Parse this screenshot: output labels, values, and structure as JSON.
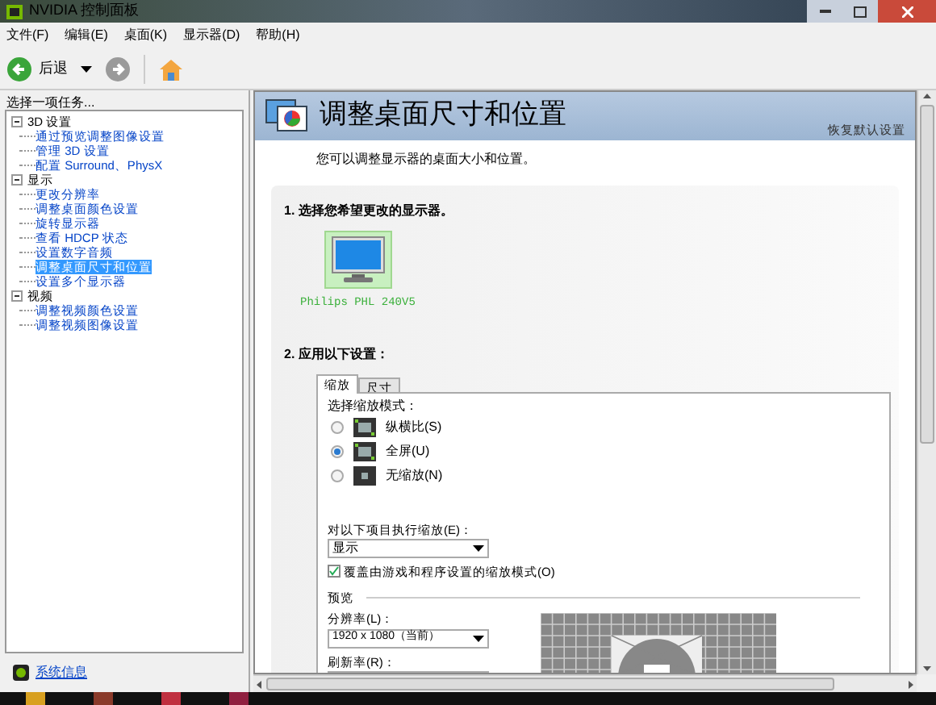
{
  "window": {
    "title": "NVIDIA 控制面板"
  },
  "menu": [
    "文件(F)",
    "编辑(E)",
    "桌面(K)",
    "显示器(D)",
    "帮助(H)"
  ],
  "toolbar": {
    "back": "后退"
  },
  "sidebar": {
    "heading": "选择一项任务...",
    "tree": [
      {
        "label": "3D 设置",
        "expanded": true,
        "children": [
          {
            "label": "通过预览调整图像设置",
            "selected": false
          },
          {
            "label": "管理 3D 设置",
            "selected": false
          },
          {
            "label": "配置 Surround、PhysX",
            "selected": false
          }
        ]
      },
      {
        "label": "显示",
        "expanded": true,
        "children": [
          {
            "label": "更改分辨率",
            "selected": false
          },
          {
            "label": "调整桌面颜色设置",
            "selected": false
          },
          {
            "label": "旋转显示器",
            "selected": false
          },
          {
            "label": "查看 HDCP 状态",
            "selected": false
          },
          {
            "label": "设置数字音频",
            "selected": false
          },
          {
            "label": "调整桌面尺寸和位置",
            "selected": true
          },
          {
            "label": "设置多个显示器",
            "selected": false
          }
        ]
      },
      {
        "label": "视频",
        "expanded": true,
        "children": [
          {
            "label": "调整视频颜色设置",
            "selected": false
          },
          {
            "label": "调整视频图像设置",
            "selected": false
          }
        ]
      }
    ],
    "footer_link": "系统信息"
  },
  "page": {
    "title": "调整桌面尺寸和位置",
    "restore_link": "恢复默认设置",
    "description": "您可以调整显示器的桌面大小和位置。",
    "step1": "1. 选择您希望更改的显示器。",
    "displays": [
      {
        "name": "Philips PHL 240V5",
        "selected": true
      }
    ],
    "step2": "2. 应用以下设置：",
    "tabs": [
      {
        "label": "缩放",
        "selected": true
      },
      {
        "label": "尺寸",
        "selected": false
      }
    ],
    "scaling_mode_label": "选择缩放模式：",
    "modes": [
      {
        "label": "纵横比(S)",
        "selected": false
      },
      {
        "label": "全屏(U)",
        "selected": true
      },
      {
        "label": "无缩放(N)",
        "selected": false
      }
    ],
    "perform_label": "对以下项目执行缩放(E)：",
    "perform_value": "显示",
    "override": {
      "label": "覆盖由游戏和程序设置的缩放模式(O)",
      "checked": true
    },
    "preview_label": "预览",
    "resolution_label": "分辨率(L)：",
    "resolution_value": "1920 x 1080（当前）",
    "refresh_label": "刷新率(R)："
  }
}
